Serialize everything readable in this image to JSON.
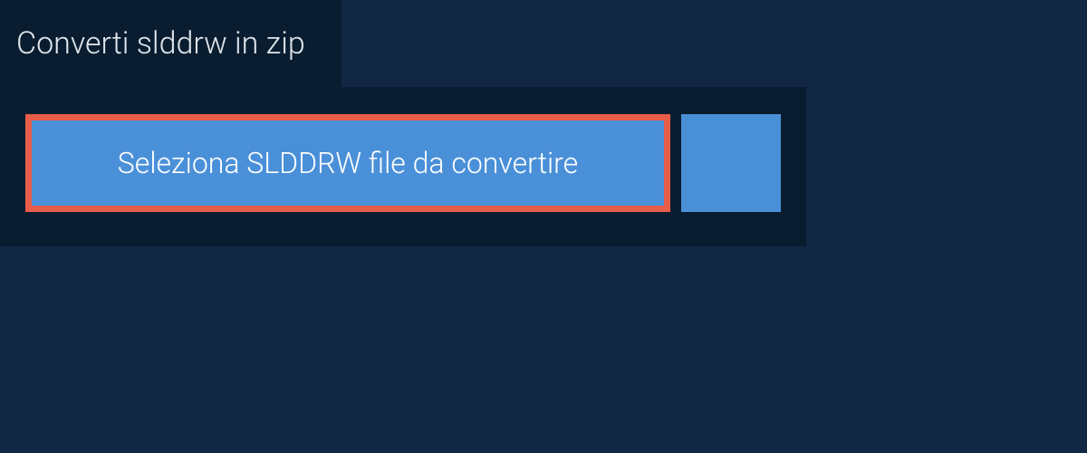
{
  "header": {
    "title": "Converti slddrw in zip"
  },
  "actions": {
    "select_file_label": "Seleziona SLDDRW file da convertire",
    "dropbox_icon": "dropbox-icon"
  },
  "colors": {
    "background": "#122744",
    "panel": "#0a1d30",
    "button_primary": "#4a90d9",
    "highlight_border": "#e85c4a",
    "text_light": "#e0e6ed"
  }
}
